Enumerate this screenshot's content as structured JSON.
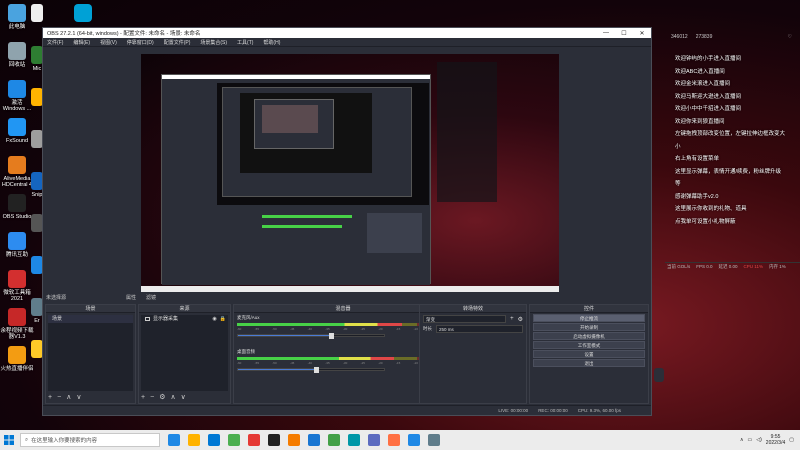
{
  "desktop_icons": [
    {
      "label": "此电脑",
      "color": "#4aa3df"
    },
    {
      "label": "回收站",
      "color": "#8fa3ad"
    },
    {
      "label": "激活 Windows ...",
      "color": "#1e88e5"
    },
    {
      "label": "FxSound",
      "color": "#2196f3"
    },
    {
      "label": "AliveMedia HDCentral 4",
      "color": "#e57c1e"
    },
    {
      "label": "OBS Studio",
      "color": "#222222"
    },
    {
      "label": "腾讯互助",
      "color": "#2d8cf0"
    },
    {
      "label": "微软工具箱 2021",
      "color": "#d32f2f"
    },
    {
      "label": "余程视频下载器V1.3",
      "color": "#c62828"
    },
    {
      "label": "火热直播伴侣",
      "color": "#f39c12"
    }
  ],
  "desktop_icons_col2": [
    {
      "label": "",
      "color": "#eeeeee"
    },
    {
      "label": "Mic",
      "color": "#2e7d32"
    },
    {
      "label": "",
      "color": "#ffb300"
    },
    {
      "label": "",
      "color": "#9e9e9e"
    },
    {
      "label": "Snip",
      "color": "#1565c0"
    },
    {
      "label": "",
      "color": "#555555"
    },
    {
      "label": "",
      "color": "#1e88e5"
    },
    {
      "label": "Er",
      "color": "#607d8b"
    },
    {
      "label": "",
      "color": "#ffca28"
    }
  ],
  "bilibili_icon": {
    "label": "",
    "color": "#00a1d6"
  },
  "obs": {
    "title": "OBS 27.2.1 (64-bit, windows) - 配置文件: 未命名 - 场景: 未命名",
    "window_buttons": [
      "—",
      "☐",
      "✕"
    ],
    "menu": [
      "文件(F)",
      "编辑(E)",
      "视图(V)",
      "停靠窗口(D)",
      "配置文件(P)",
      "场景集合(S)",
      "工具(T)",
      "帮助(H)"
    ],
    "docks_header_label": "未选择源",
    "docks_header_tabs": [
      "属性",
      "滤镜"
    ],
    "scenes": {
      "title": "场景",
      "items": [
        "场景"
      ],
      "foot": [
        "+",
        "−",
        "∧",
        "∨"
      ]
    },
    "sources": {
      "title": "来源",
      "items": [
        "显示器采集"
      ],
      "foot": [
        "+",
        "−",
        "⚙",
        "∧",
        "∨"
      ]
    },
    "mixer": {
      "title": "混音器",
      "channels": [
        {
          "name": "麦克风/Aux",
          "db": "0.0 dB",
          "level": 0.78,
          "volume": 0.62
        },
        {
          "name": "桌面音频",
          "db": "-0.7 dB",
          "level": 0.74,
          "volume": 0.52
        }
      ],
      "scale": [
        "-60",
        "-55",
        "-50",
        "-45",
        "-40",
        "-35",
        "-30",
        "-25",
        "-20",
        "-15",
        "-10",
        "-5",
        "0"
      ]
    },
    "transitions": {
      "title": "转场特效",
      "type": "渐变",
      "duration_label": "时长",
      "duration": "250 ms"
    },
    "controls": {
      "title": "控件",
      "buttons": [
        "停止推流",
        "开始录制",
        "启动虚拟摄像机",
        "工作室模式",
        "设置",
        "退出"
      ],
      "active_index": 0
    },
    "status": {
      "live": "LIVE: 00:00:00",
      "rec": "REC: 00:00:00",
      "cpu": "CPU: 9.3%, 60.00 fps"
    }
  },
  "chat": {
    "top": [
      "346012",
      "273839",
      "♡"
    ],
    "lines": [
      "欢迎钟屿的小手进入直播间",
      "欢迎ABC进入直播间",
      "欢迎金米滚进入直播间",
      "欢迎马斯迎大逊进入直播间",
      "欢迎小中中千招进入直播间",
      "欢迎你来到狼直播间",
      "左键拖拽顶部改变位置，左键拉伸边框改变大",
      "小",
      "右上角有设置菜单",
      "这里显示弹幕，表情开通/续费，粉丝牌升级",
      "等",
      "感谢弹幕助手v2.0",
      "这里展示你收到的礼物、道具",
      "点我单可设置小礼物屏蔽"
    ],
    "bottom": [
      "当前 GOL/s",
      "FPS 0.0",
      "延迟 0.00",
      "CPU 11%",
      "内存 1%"
    ]
  },
  "taskbar": {
    "search_placeholder": "在这里输入你要搜索的内容",
    "time": "9:55",
    "date": "2022/3/4",
    "apps": [
      "#1e88e5",
      "#ffb300",
      "#0078d4",
      "#4caf50",
      "#e53935",
      "#222222",
      "#f57c00",
      "#1976d2",
      "#43a047",
      "#0097a7",
      "#5c6bc0",
      "#ff7043",
      "#1e88e5",
      "#607d8b"
    ]
  }
}
